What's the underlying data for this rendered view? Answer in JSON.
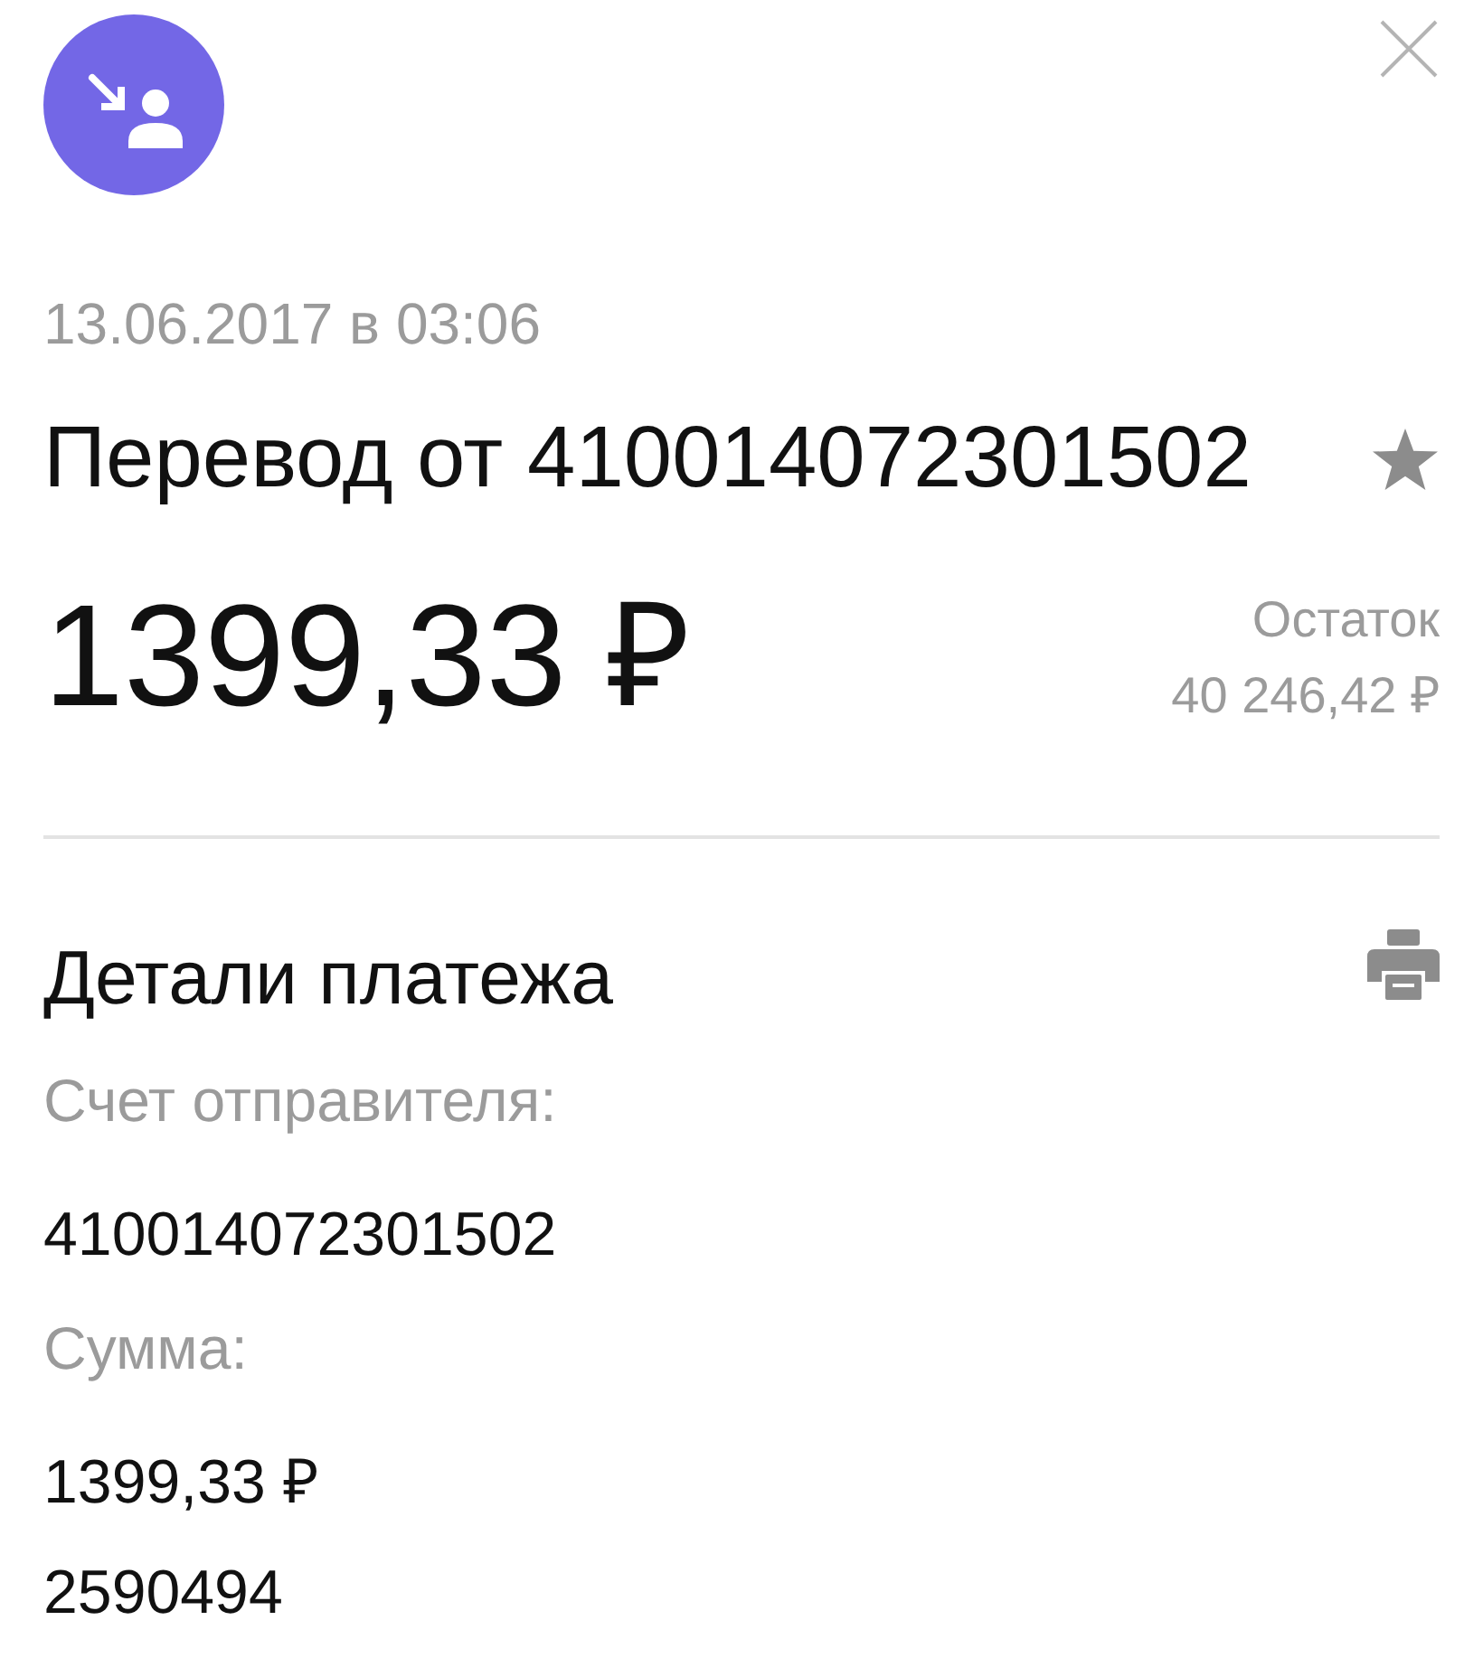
{
  "date": "13.06.2017 в 03:06",
  "title": {
    "text": "Перевод от 410014072301502",
    "starred": false
  },
  "amount": "1399,33 ₽",
  "balance": {
    "label": "Остаток",
    "value": "40 246,42 ₽"
  },
  "details": {
    "title": "Детали платежа",
    "rows": [
      {
        "kind": "label",
        "text": "Счет отправителя:"
      },
      {
        "kind": "value",
        "text": "410014072301502"
      },
      {
        "kind": "label",
        "text": "Сумма:"
      },
      {
        "kind": "value",
        "text": "1399,33 ₽"
      },
      {
        "kind": "value",
        "text": "2590494"
      }
    ]
  }
}
